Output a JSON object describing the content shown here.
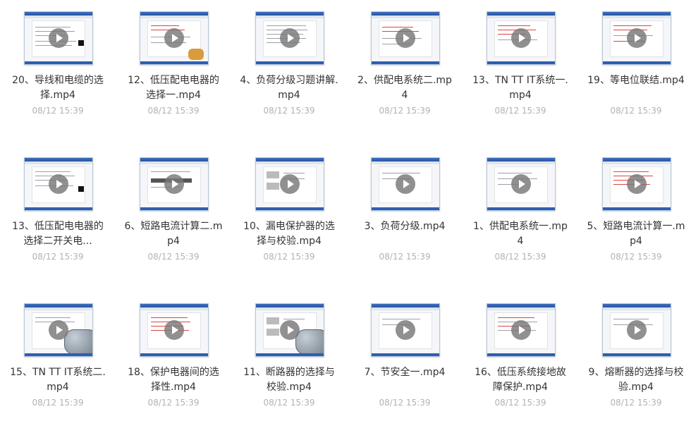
{
  "videos": [
    {
      "title": "20、导线和电缆的选择.mp4",
      "date": "08/12 15:39"
    },
    {
      "title": "12、低压配电电器的选择一.mp4",
      "date": "08/12 15:39"
    },
    {
      "title": "4、负荷分级习题讲解.mp4",
      "date": "08/12 15:39"
    },
    {
      "title": "2、供配电系统二.mp4",
      "date": "08/12 15:39"
    },
    {
      "title": "13、TN TT IT系统一.mp4",
      "date": "08/12 15:39"
    },
    {
      "title": "19、等电位联结.mp4",
      "date": "08/12 15:39"
    },
    {
      "title": "13、低压配电电器的选择二开关电...",
      "date": "08/12 15:39"
    },
    {
      "title": "6、短路电流计算二.mp4",
      "date": "08/12 15:39"
    },
    {
      "title": "10、漏电保护器的选择与校验.mp4",
      "date": "08/12 15:39"
    },
    {
      "title": "3、负荷分级.mp4",
      "date": "08/12 15:39"
    },
    {
      "title": "1、供配电系统一.mp4",
      "date": "08/12 15:39"
    },
    {
      "title": "5、短路电流计算一.mp4",
      "date": "08/12 15:39"
    },
    {
      "title": "15、TN TT IT系统二.mp4",
      "date": "08/12 15:39"
    },
    {
      "title": "18、保护电器间的选择性.mp4",
      "date": "08/12 15:39"
    },
    {
      "title": "11、断路器的选择与校验.mp4",
      "date": "08/12 15:39"
    },
    {
      "title": "7、节安全一.mp4",
      "date": "08/12 15:39"
    },
    {
      "title": "16、低压系统接地故障保护.mp4",
      "date": "08/12 15:39"
    },
    {
      "title": "9、熔断器的选择与校验.mp4",
      "date": "08/12 15:39"
    }
  ],
  "icons": {
    "play": "play-icon"
  }
}
